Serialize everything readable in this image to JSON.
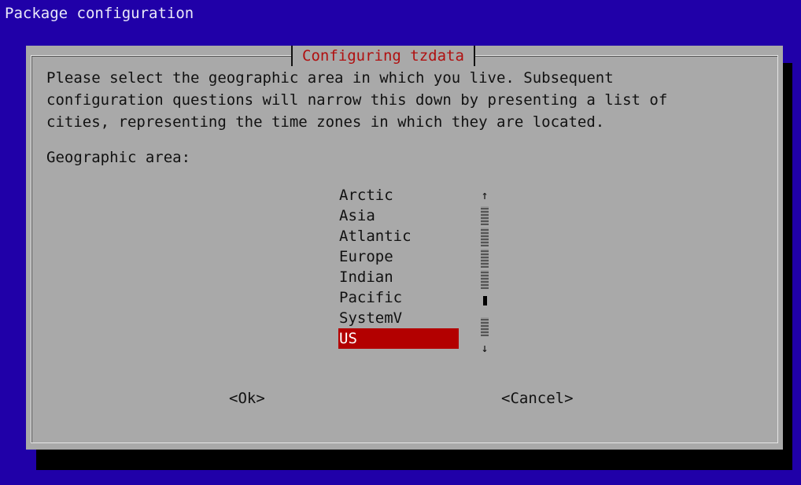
{
  "backtitle": "Package configuration",
  "dialog": {
    "title": "Configuring tzdata",
    "prompt_lines": [
      "Please select the geographic area in which you live. Subsequent",
      "configuration questions will narrow this down by presenting a list of",
      "cities, representing the time zones in which they are located."
    ],
    "list_label": "Geographic area:",
    "items": [
      "Arctic",
      "Asia",
      "Atlantic",
      "Europe",
      "Indian",
      "Pacific",
      "SystemV",
      "US"
    ],
    "selected_item": "US",
    "scroll_up_glyph": "↑",
    "scroll_down_glyph": "↓",
    "ok_label": "<Ok>",
    "cancel_label": "<Cancel>"
  },
  "colors": {
    "background": "#2000a8",
    "dialog": "#a9a9a9",
    "title": "#b01010",
    "selection": "#b30000"
  }
}
